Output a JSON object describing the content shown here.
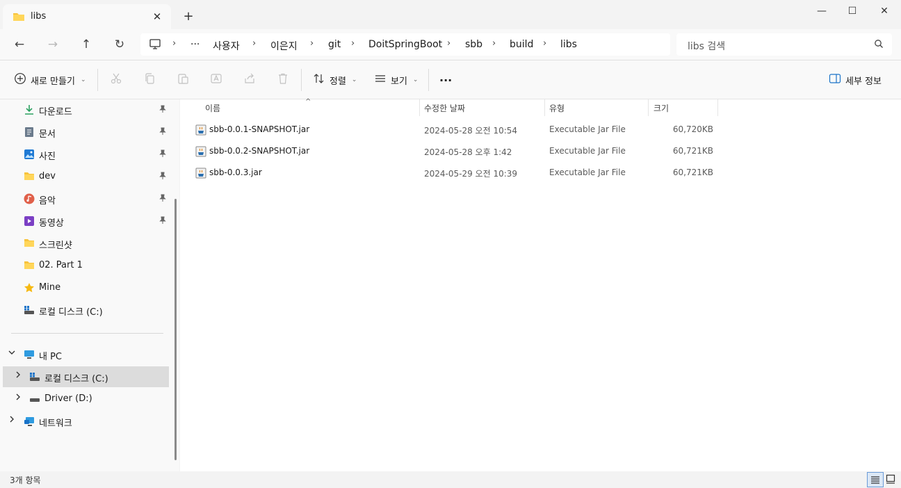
{
  "tab": {
    "title": "libs",
    "close": "✕"
  },
  "window": {
    "minimize": "—",
    "maximize": "☐",
    "close": "✕",
    "new_tab": "+"
  },
  "nav": {
    "back": "←",
    "forward": "→",
    "up": "↑",
    "refresh": "↻"
  },
  "breadcrumb": {
    "more": "···",
    "items": [
      "사용자",
      "이은지",
      "git",
      "DoitSpringBoot",
      "sbb",
      "build",
      "libs"
    ],
    "separator": "›"
  },
  "search": {
    "placeholder": "libs 검색"
  },
  "toolbar": {
    "new_label": "새로 만들기",
    "sort_label": "정렬",
    "view_label": "보기",
    "more_label": "···",
    "details_label": "세부 정보"
  },
  "sidebar": {
    "quick_access": [
      {
        "label": "다운로드",
        "icon": "download-icon",
        "pinned": true
      },
      {
        "label": "문서",
        "icon": "document-icon",
        "pinned": true
      },
      {
        "label": "사진",
        "icon": "pictures-icon",
        "pinned": true
      },
      {
        "label": "dev",
        "icon": "folder-icon",
        "pinned": true
      },
      {
        "label": "음악",
        "icon": "music-icon",
        "pinned": true
      },
      {
        "label": "동영상",
        "icon": "video-icon",
        "pinned": true
      },
      {
        "label": "스크린샷",
        "icon": "folder-icon",
        "pinned": false
      },
      {
        "label": "02. Part 1",
        "icon": "folder-icon",
        "pinned": false
      },
      {
        "label": "Mine",
        "icon": "star-icon",
        "pinned": false
      },
      {
        "label": "로컬 디스크 (C:)",
        "icon": "drive-icon",
        "pinned": false
      }
    ],
    "this_pc": {
      "label": "내 PC"
    },
    "drives": [
      {
        "label": "로컬 디스크 (C:)"
      },
      {
        "label": "Driver (D:)"
      }
    ],
    "network": {
      "label": "네트워크"
    }
  },
  "columns": {
    "name": "이름",
    "modified": "수정한 날짜",
    "type": "유형",
    "size": "크기"
  },
  "files": [
    {
      "name": "sbb-0.0.1-SNAPSHOT.jar",
      "modified": "2024-05-28 오전 10:54",
      "type": "Executable Jar File",
      "size": "60,720KB"
    },
    {
      "name": "sbb-0.0.2-SNAPSHOT.jar",
      "modified": "2024-05-28 오후 1:42",
      "type": "Executable Jar File",
      "size": "60,721KB"
    },
    {
      "name": "sbb-0.0.3.jar",
      "modified": "2024-05-29 오전 10:39",
      "type": "Executable Jar File",
      "size": "60,721KB"
    }
  ],
  "status": {
    "count": "3개 항목"
  },
  "colors": {
    "folder": "#f8c33c",
    "accent": "#1a73c8",
    "selected": "#dcdcdc"
  }
}
